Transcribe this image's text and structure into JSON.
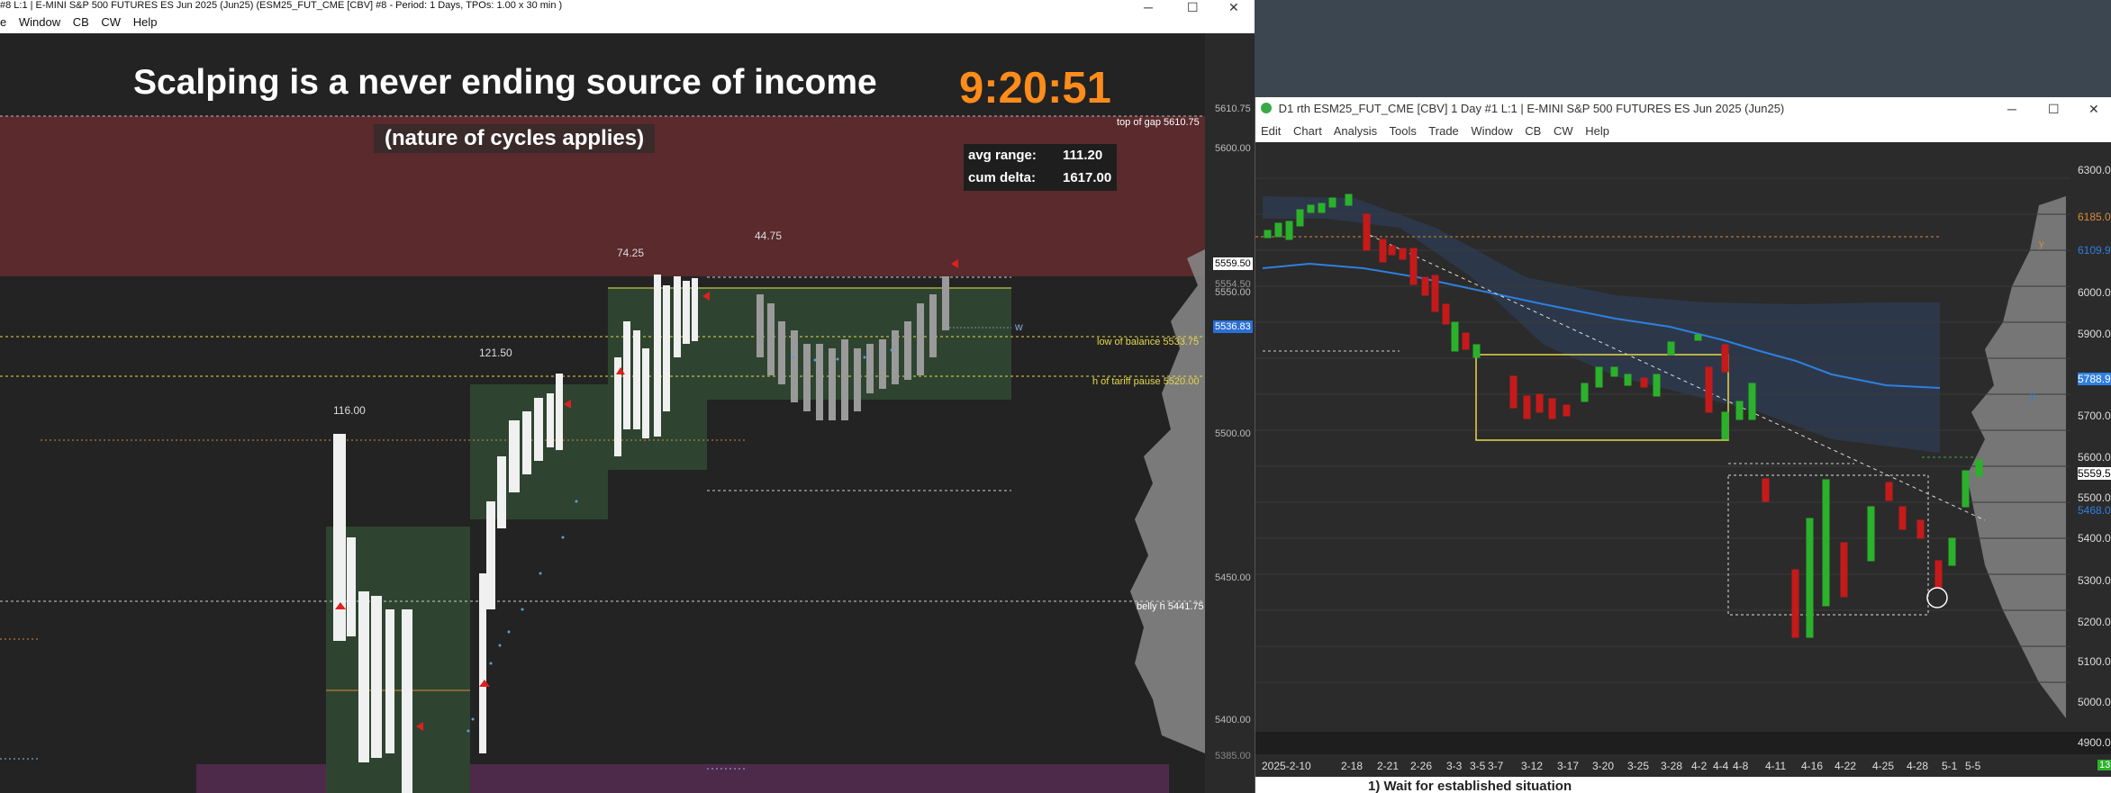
{
  "left_window": {
    "title": "#8 L:1 | E-MINI S&P 500 FUTURES ES Jun 2025 (Jun25) (ESM25_FUT_CME [CBV] #8 - Period: 1 Days,  TPOs: 1.00 x 30 min  )",
    "menu": [
      "e",
      "Window",
      "CB",
      "CW",
      "Help"
    ],
    "headline": "Scalping is a never ending source of income",
    "subheadline": "(nature of cycles applies)",
    "clock": "9:20:51",
    "stats": {
      "avg_range_label": "avg range:",
      "avg_range_value": "111.20",
      "cum_delta_label": "cum delta:",
      "cum_delta_value": "1617.00"
    },
    "range_labels": [
      "116.00",
      "121.50",
      "74.25",
      "44.75"
    ],
    "levels": [
      {
        "name": "top of gap",
        "price": "5610.75"
      },
      {
        "name": "low of balance",
        "price": "5533.75"
      },
      {
        "name": "h of tariff pause",
        "price": "5520.00"
      },
      {
        "name": "belly h",
        "price": "5441.75"
      }
    ],
    "price_axis": [
      "5610.75",
      "5600.00",
      "5559.50",
      "5554.50",
      "5536.83",
      "5550.00",
      "5500.00",
      "5450.00",
      "5400.00",
      "5385.00"
    ],
    "w_marker": "w",
    "colors": {
      "gap_zone": "#5a2a2c",
      "balance_zone": "#2e4430",
      "clock": "#ff8c1a",
      "level_line": "#e8d84a",
      "bottom_band": "#4d2a4a"
    }
  },
  "right_window": {
    "title": "D1 rth ESM25_FUT_CME [CBV]  1 Day  #1 L:1 | E-MINI S&P 500 FUTURES ES Jun 2025 (Jun25)",
    "menu": [
      "Edit",
      "Chart",
      "Analysis",
      "Tools",
      "Trade",
      "Window",
      "CB",
      "CW",
      "Help"
    ],
    "price_axis": [
      "6300.00",
      "6185.00",
      "6109.93",
      "6000.00",
      "5900.00",
      "5788.98",
      "5700.00",
      "5600.00",
      "5559.50",
      "5500.00",
      "5468.00",
      "5400.00",
      "5300.00",
      "5200.00",
      "5100.00",
      "5000.00",
      "4900.00"
    ],
    "date_axis": [
      "2025-2-10",
      "2-18",
      "2-21",
      "2-26",
      "3-3",
      "3-5",
      "3-7",
      "3-12",
      "3-17",
      "3-20",
      "3-25",
      "3-28",
      "4-2",
      "4-4",
      "4-8",
      "4-11",
      "4-16",
      "4-22",
      "4-25",
      "4-28",
      "5-1",
      "5-5"
    ],
    "corner_badge": "13",
    "markers": [
      "y",
      "y"
    ],
    "bottom_text": "1)   Wait for established situation"
  }
}
